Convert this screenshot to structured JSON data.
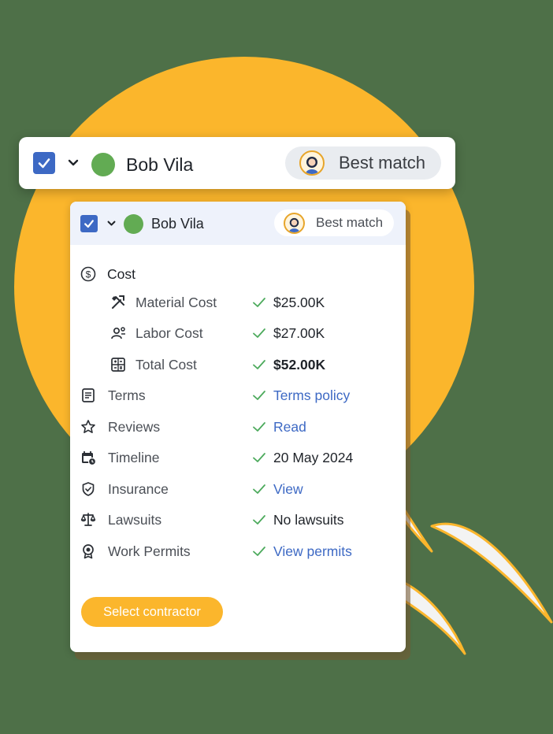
{
  "colors": {
    "background": "#4e7048",
    "blob": "#fbb62c",
    "accent_blue": "#3d69c4",
    "check_green": "#4caa5c",
    "status_dot": "#62ab53",
    "button": "#fbb62c"
  },
  "top_bar": {
    "checkbox_checked": true,
    "name": "Bob Vila",
    "badge": "Best match",
    "avatar_icon": "woman-avatar-icon"
  },
  "card": {
    "header": {
      "checkbox_checked": true,
      "name": "Bob Vila",
      "badge": "Best match",
      "avatar_icon": "woman-avatar-icon"
    },
    "cost": {
      "title": "Cost",
      "icon": "dollar-circle-icon",
      "items": [
        {
          "label": "Material Cost",
          "value": "$25.00K",
          "icon": "tools-icon"
        },
        {
          "label": "Labor Cost",
          "value": "$27.00K",
          "icon": "workers-icon"
        },
        {
          "label": "Total Cost",
          "value": "$52.00K",
          "icon": "calculator-icon"
        }
      ]
    },
    "details": [
      {
        "label": "Terms",
        "value": "Terms policy",
        "icon": "document-icon"
      },
      {
        "label": "Reviews",
        "value": "Read",
        "icon": "star-icon"
      },
      {
        "label": "Timeline",
        "value": "20 May 2024",
        "icon": "calendar-clock-icon"
      },
      {
        "label": "Insurance",
        "value": "View",
        "icon": "shield-check-icon"
      },
      {
        "label": "Lawsuits",
        "value": "No lawsuits",
        "icon": "scale-icon"
      },
      {
        "label": "Work Permits",
        "value": "View permits",
        "icon": "badge-icon"
      }
    ],
    "select_button": "Select contractor"
  }
}
